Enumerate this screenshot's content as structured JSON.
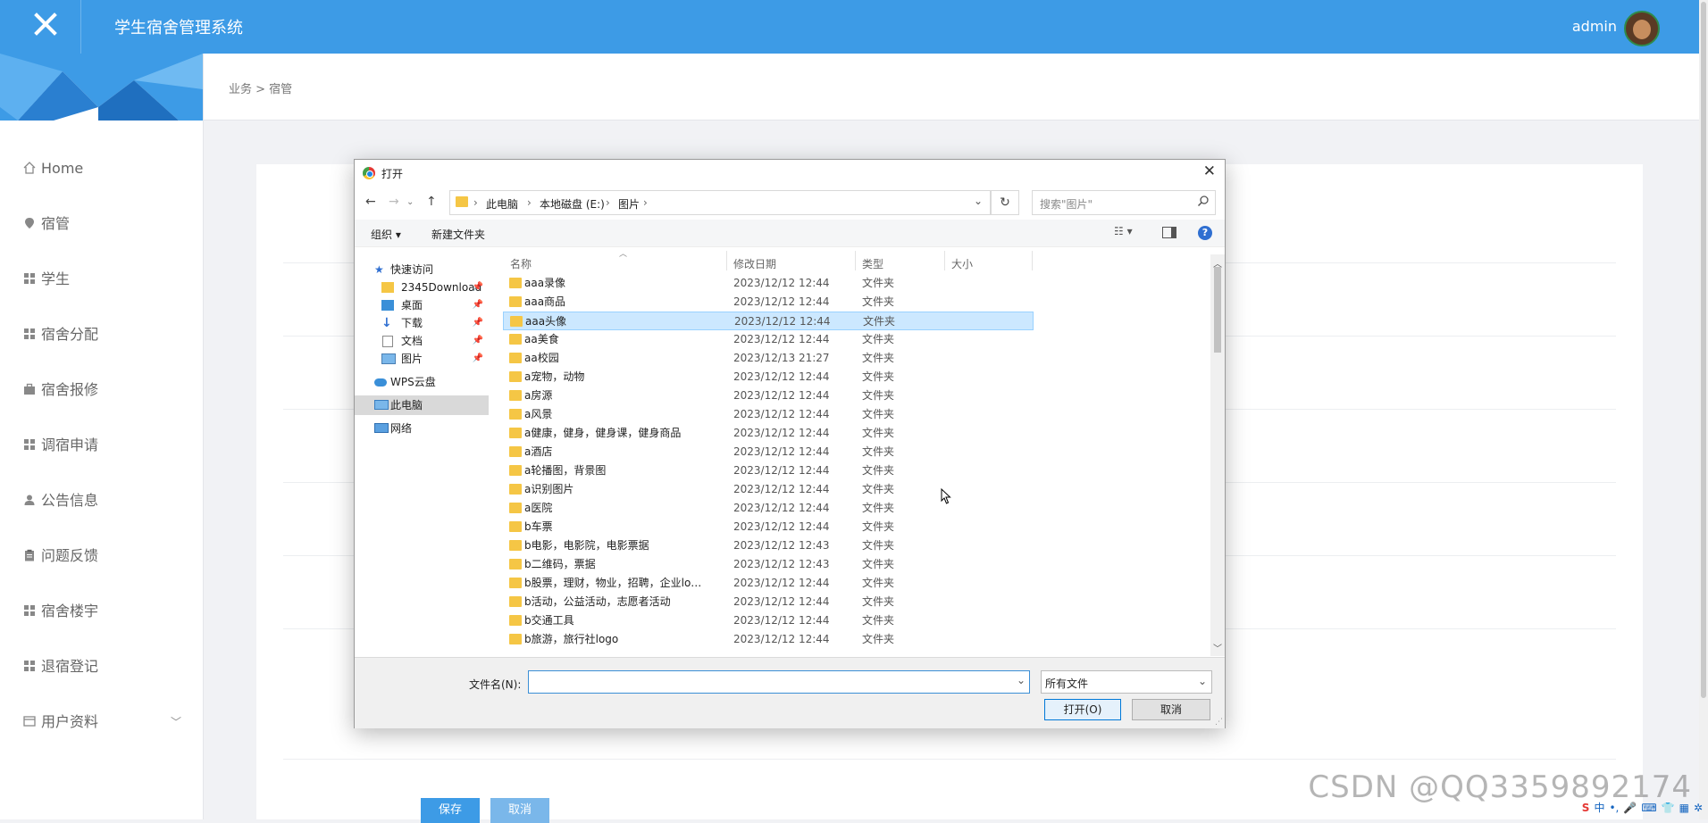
{
  "app": {
    "title": "学生宿舍管理系统",
    "user": "admin"
  },
  "sidebar": {
    "items": [
      {
        "label": "Home",
        "icon": "home-icon"
      },
      {
        "label": "宿管",
        "icon": "location-icon"
      },
      {
        "label": "学生",
        "icon": "grid-icon"
      },
      {
        "label": "宿舍分配",
        "icon": "grid-icon"
      },
      {
        "label": "宿舍报修",
        "icon": "briefcase-icon"
      },
      {
        "label": "调宿申请",
        "icon": "grid-icon"
      },
      {
        "label": "公告信息",
        "icon": "person-icon"
      },
      {
        "label": "问题反馈",
        "icon": "clipboard-icon"
      },
      {
        "label": "宿舍楼宇",
        "icon": "grid-icon"
      },
      {
        "label": "退宿登记",
        "icon": "grid-icon"
      },
      {
        "label": "用户资料",
        "icon": "window-icon"
      }
    ]
  },
  "breadcrumb": "业务 > 宿管",
  "form": {
    "save_label": "保存",
    "cancel_label": "取消"
  },
  "watermark": "CSDN @QQ3359892174",
  "dialog": {
    "title": "打开",
    "address": [
      "此电脑",
      "本地磁盘 (E:)",
      "图片"
    ],
    "search_placeholder": "搜索\"图片\"",
    "toolbar": {
      "organize": "组织 ▾",
      "new_folder": "新建文件夹"
    },
    "columns": {
      "name": "名称",
      "date": "修改日期",
      "type": "类型",
      "size": "大小"
    },
    "nav": {
      "quick_access": "快速访问",
      "pinned": [
        "2345Download",
        "桌面",
        "下载",
        "文档",
        "图片"
      ],
      "wps": "WPS云盘",
      "this_pc": "此电脑",
      "network": "网络"
    },
    "files": [
      {
        "name": "aaa录像",
        "date": "2023/12/12 12:44",
        "type": "文件夹"
      },
      {
        "name": "aaa商品",
        "date": "2023/12/12 12:44",
        "type": "文件夹"
      },
      {
        "name": "aaa头像",
        "date": "2023/12/12 12:44",
        "type": "文件夹"
      },
      {
        "name": "aa美食",
        "date": "2023/12/12 12:44",
        "type": "文件夹"
      },
      {
        "name": "aa校园",
        "date": "2023/12/13 21:27",
        "type": "文件夹"
      },
      {
        "name": "a宠物，动物",
        "date": "2023/12/12 12:44",
        "type": "文件夹"
      },
      {
        "name": "a房源",
        "date": "2023/12/12 12:44",
        "type": "文件夹"
      },
      {
        "name": "a风景",
        "date": "2023/12/12 12:44",
        "type": "文件夹"
      },
      {
        "name": "a健康，健身，健身课，健身商品",
        "date": "2023/12/12 12:44",
        "type": "文件夹"
      },
      {
        "name": "a酒店",
        "date": "2023/12/12 12:44",
        "type": "文件夹"
      },
      {
        "name": "a轮播图，背景图",
        "date": "2023/12/12 12:44",
        "type": "文件夹"
      },
      {
        "name": "a识别图片",
        "date": "2023/12/12 12:44",
        "type": "文件夹"
      },
      {
        "name": "a医院",
        "date": "2023/12/12 12:44",
        "type": "文件夹"
      },
      {
        "name": "b车票",
        "date": "2023/12/12 12:44",
        "type": "文件夹"
      },
      {
        "name": "b电影，电影院，电影票据",
        "date": "2023/12/12 12:43",
        "type": "文件夹"
      },
      {
        "name": "b二维码，票据",
        "date": "2023/12/12 12:43",
        "type": "文件夹"
      },
      {
        "name": "b股票，理财，物业，招聘，企业logo，...",
        "date": "2023/12/12 12:44",
        "type": "文件夹"
      },
      {
        "name": "b活动，公益活动，志愿者活动",
        "date": "2023/12/12 12:44",
        "type": "文件夹"
      },
      {
        "name": "b交通工具",
        "date": "2023/12/12 12:44",
        "type": "文件夹"
      },
      {
        "name": "b旅游，旅行社logo",
        "date": "2023/12/12 12:44",
        "type": "文件夹"
      }
    ],
    "selected_index": 2,
    "filename_label": "文件名(N):",
    "filename_value": "",
    "filetype": "所有文件",
    "open_label": "打开(O)",
    "cancel_label": "取消"
  },
  "colors": {
    "primary": "#3d9be6",
    "selection": "#cce8ff"
  }
}
